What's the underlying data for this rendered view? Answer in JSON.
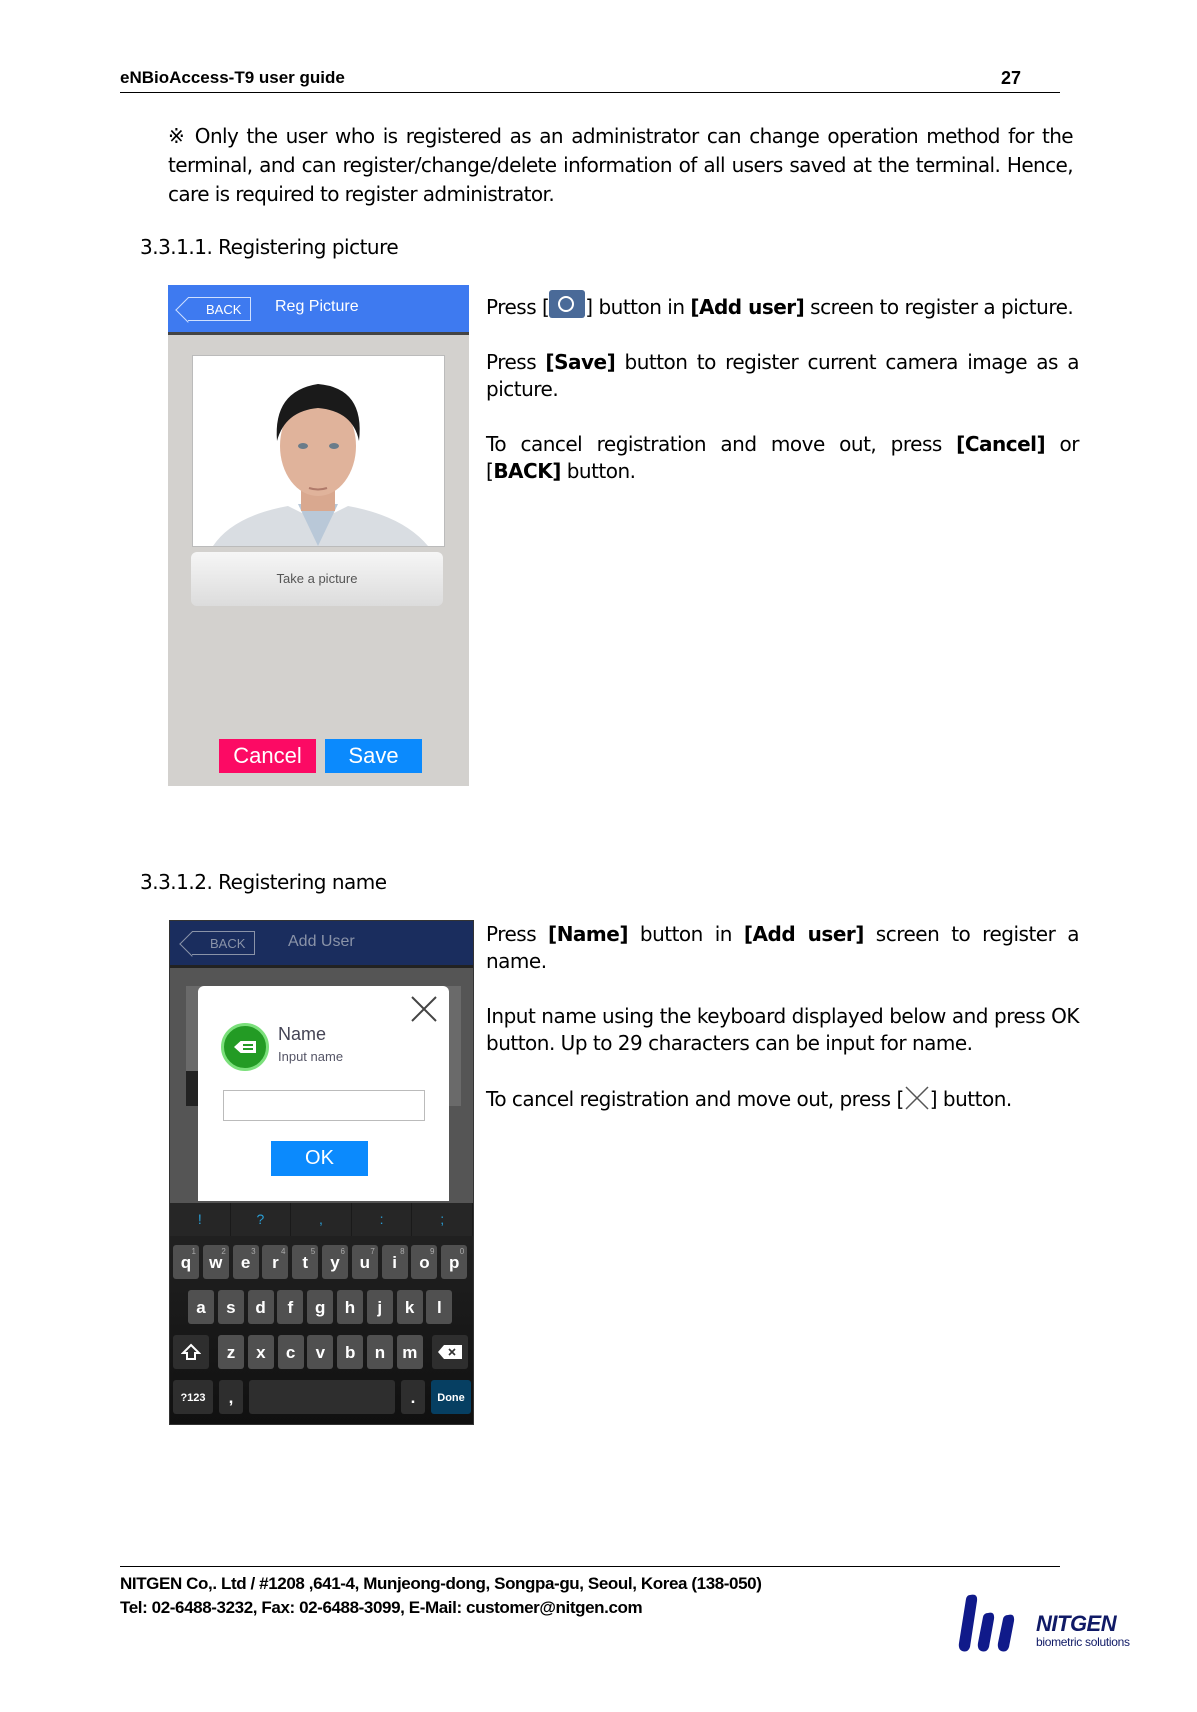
{
  "header": {
    "title": "eNBioAccess-T9 user guide",
    "page_number": "27"
  },
  "note": "※  Only the user who is registered as an administrator can change operation method for the terminal, and can register/change/delete information of all users saved at the terminal. Hence, care is required to register administrator.",
  "section1": {
    "heading": "3.3.1.1. Registering picture",
    "screen": {
      "back_label": "BACK",
      "title": "Reg Picture",
      "take_picture_label": "Take a picture",
      "cancel_label": "Cancel",
      "save_label": "Save",
      "colors": {
        "header": "#3e7af0",
        "cancel": "#fc0a64",
        "save": "#0b8afd"
      }
    },
    "desc": {
      "p1_a": " Press [",
      "p1_b": "] button in ",
      "p1_bold": "[Add user]",
      "p1_c": " screen to register a picture.",
      "p2_a": "Press ",
      "p2_bold": "[Save]",
      "p2_c": " button to register current camera image as a picture.",
      "p3_a": "To cancel registration and move out, press ",
      "p3_bold1": "[Cancel]",
      "p3_b": " or [",
      "p3_bold2": "BACK]",
      "p3_c": " button."
    }
  },
  "section2": {
    "heading": "3.3.1.2. Registering name",
    "screen": {
      "back_label": "BACK",
      "title": "Add User",
      "dialog_title": "Name",
      "dialog_subtitle": "Input name",
      "input_value": "",
      "ok_label": "OK",
      "suggestions": [
        "!",
        "?",
        ",",
        ":",
        ";"
      ],
      "row1": [
        "q",
        "w",
        "e",
        "r",
        "t",
        "y",
        "u",
        "i",
        "o",
        "p"
      ],
      "row1_hints": [
        "1",
        "2",
        "3",
        "4",
        "5",
        "6",
        "7",
        "8",
        "9",
        "0"
      ],
      "row2": [
        "a",
        "s",
        "d",
        "f",
        "g",
        "h",
        "j",
        "k",
        "l"
      ],
      "row3": [
        "z",
        "x",
        "c",
        "v",
        "b",
        "n",
        "m"
      ],
      "symbols_label": "?123",
      "comma_label": ",",
      "period_label": ".",
      "done_label": "Done"
    },
    "desc": {
      "p1_a": " Press ",
      "p1_bold1": "[Name]",
      "p1_b": " button in ",
      "p1_bold2": "[Add user]",
      "p1_c": " screen to register a name.",
      "p2": "Input name using the keyboard displayed below and press OK button. Up to 29 characters can be input for name.",
      "p3_a": "To cancel registration and move out, press [",
      "p3_b": "] button."
    }
  },
  "footer": {
    "address": "NITGEN Co,. Ltd / #1208 ,641-4, Munjeong-dong, Songpa-gu, Seoul, Korea (138-050)",
    "contact": "Tel: 02-6488-3232, Fax: 02-6488-3099, E-Mail: customer@nitgen.com",
    "logo_brand": "NITGEN",
    "logo_tagline": "biometric solutions"
  }
}
